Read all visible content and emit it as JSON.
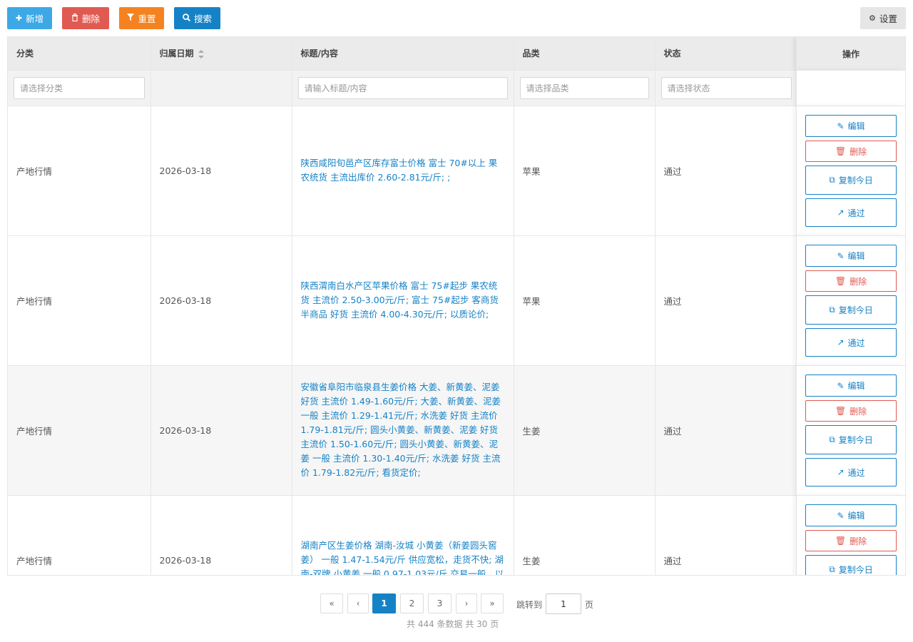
{
  "toolbar": {
    "add_label": "新增",
    "delete_label": "删除",
    "reset_label": "重置",
    "search_label": "搜索",
    "settings_label": "设置"
  },
  "table": {
    "columns": [
      "分类",
      "归属日期",
      "标题/内容",
      "品类",
      "状态",
      "操作"
    ],
    "filters": {
      "category_placeholder": "请选择分类",
      "title_placeholder": "请输入标题/内容",
      "variety_placeholder": "请选择品类",
      "status_placeholder": "请选择状态"
    },
    "rows": [
      {
        "category": "产地行情",
        "date": "2026-03-18",
        "title": "陕西咸阳旬邑产区库存富士价格 富士 70#以上 果农统货 主流出库价 2.60-2.81元/斤; ;",
        "variety": "苹果",
        "status": "通过"
      },
      {
        "category": "产地行情",
        "date": "2026-03-18",
        "title": "陕西渭南白水产区苹果价格 富士 75#起步 果农统货 主流价 2.50-3.00元/斤; 富士 75#起步 客商货 半商品 好货 主流价 4.00-4.30元/斤; 以质论价;",
        "variety": "苹果",
        "status": "通过"
      },
      {
        "category": "产地行情",
        "date": "2026-03-18",
        "title": "安徽省阜阳市临泉县生姜价格 大姜、新黄姜、泥姜 好货 主流价 1.49-1.60元/斤; 大姜、新黄姜、泥姜 一般 主流价 1.29-1.41元/斤; 水洗姜 好货 主流价 1.79-1.81元/斤; 圆头小黄姜、新黄姜、泥姜 好货 主流价 1.50-1.60元/斤; 圆头小黄姜、新黄姜、泥姜 一般 主流价 1.30-1.40元/斤; 水洗姜 好货 主流价 1.79-1.82元/斤; 看货定价;",
        "variety": "生姜",
        "status": "通过"
      },
      {
        "category": "产地行情",
        "date": "2026-03-18",
        "title": "湖南产区生姜价格 湖南-汝城 小黄姜（新姜圆头窖姜） 一般 1.47-1.54元/斤 供应宽松，走货不快; 湖南-双牌 小黄姜 一般 0.97-1.03元/斤 交易一般，以",
        "variety": "生姜",
        "status": "通过"
      }
    ],
    "actions": {
      "edit": "编辑",
      "delete": "删除",
      "copy_today": "复制今日",
      "approve": "通过"
    }
  },
  "pagination": {
    "first": "«",
    "prev": "‹",
    "pages": [
      "1",
      "2",
      "3"
    ],
    "current": "1",
    "next": "›",
    "last": "»",
    "goto_label": "跳转到",
    "goto_value": "1",
    "goto_unit": "页",
    "summary": "共 444 条数据   共 30 页"
  },
  "icons": {
    "add": "plus-icon",
    "delete": "trash-icon",
    "reset": "filter-icon",
    "search": "search-icon",
    "settings": "gear-icon",
    "edit": "edit-icon",
    "copy": "copy-icon",
    "approve": "external-link-icon"
  },
  "colors": {
    "primary": "#1682c6",
    "add": "#3da8e6",
    "danger": "#e05a52",
    "warning": "#f58220"
  }
}
